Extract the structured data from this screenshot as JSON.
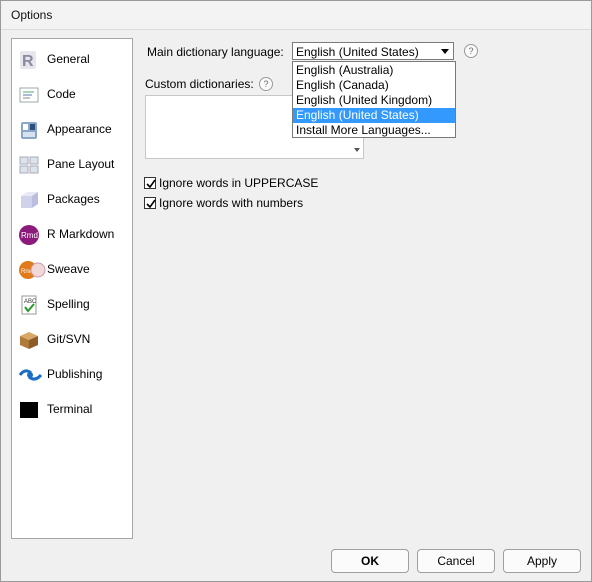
{
  "window": {
    "title": "Options"
  },
  "sidebar": {
    "items": [
      {
        "label": "General",
        "icon": "r-logo-icon"
      },
      {
        "label": "Code",
        "icon": "code-icon"
      },
      {
        "label": "Appearance",
        "icon": "appearance-icon"
      },
      {
        "label": "Pane Layout",
        "icon": "pane-layout-icon"
      },
      {
        "label": "Packages",
        "icon": "packages-icon"
      },
      {
        "label": "R Markdown",
        "icon": "rmarkdown-icon"
      },
      {
        "label": "Sweave",
        "icon": "sweave-icon"
      },
      {
        "label": "Spelling",
        "icon": "spelling-icon"
      },
      {
        "label": "Git/SVN",
        "icon": "git-svn-icon"
      },
      {
        "label": "Publishing",
        "icon": "publishing-icon"
      },
      {
        "label": "Terminal",
        "icon": "terminal-icon"
      }
    ],
    "selected_index": 7
  },
  "spelling": {
    "main_dictionary_label": "Main dictionary language:",
    "main_dictionary_value": "English (United States)",
    "dropdown_options": [
      "English (Australia)",
      "English (Canada)",
      "English (United Kingdom)",
      "English (United States)",
      "Install More Languages..."
    ],
    "dropdown_selected_index": 3,
    "custom_dictionaries_label": "Custom dictionaries:",
    "help_glyph": "?",
    "checkboxes": [
      {
        "label": "Ignore words in UPPERCASE",
        "checked": true
      },
      {
        "label": "Ignore words with numbers",
        "checked": true
      }
    ]
  },
  "buttons": {
    "ok": "OK",
    "cancel": "Cancel",
    "apply": "Apply"
  },
  "colors": {
    "selection": "#3399ff",
    "window_bg": "#f0f0f0"
  }
}
